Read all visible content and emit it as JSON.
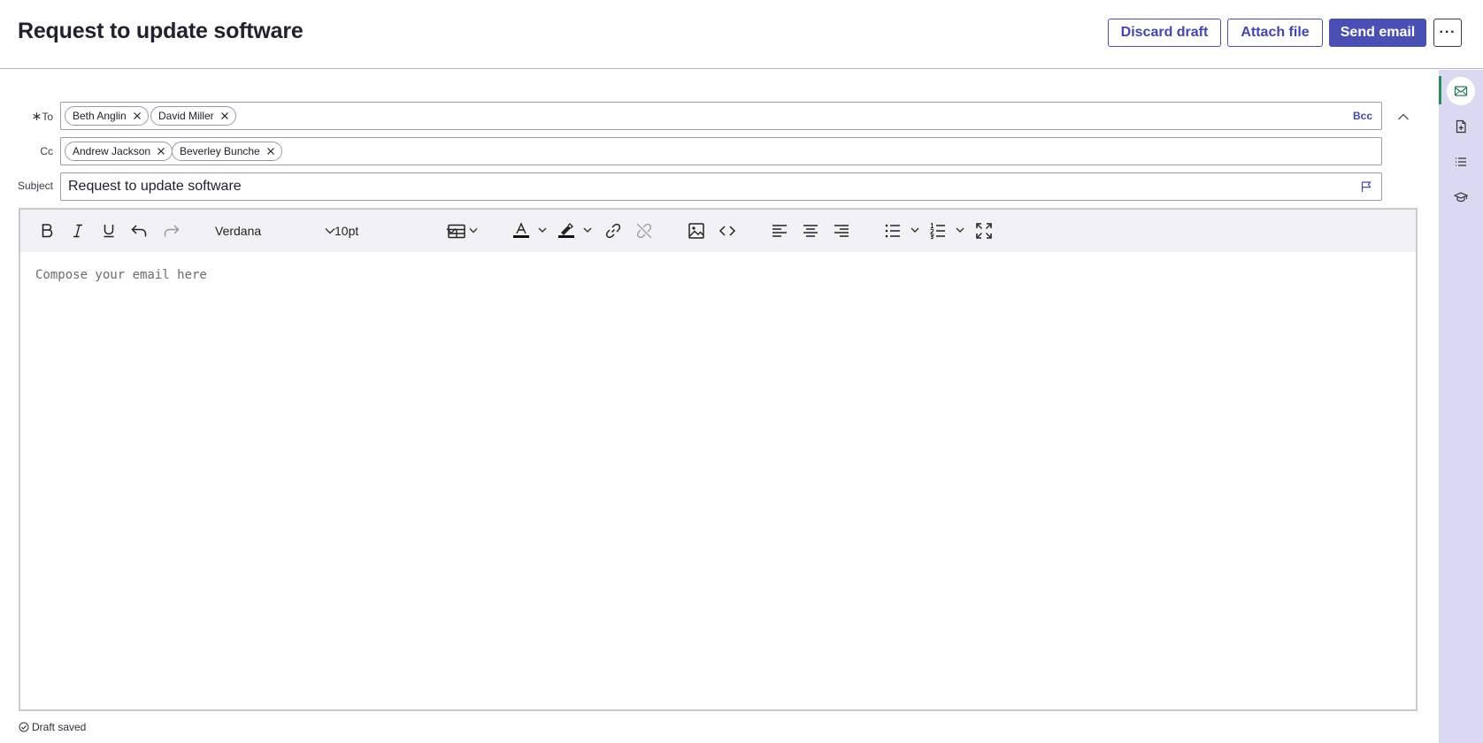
{
  "header": {
    "title": "Request to update software",
    "discard_label": "Discard draft",
    "attach_label": "Attach file",
    "send_label": "Send email",
    "more_label": "···"
  },
  "to": {
    "label": "To",
    "required_marker": "∗",
    "recipients": [
      "Beth Anglin",
      "David Miller"
    ],
    "bcc_label": "Bcc"
  },
  "cc": {
    "label": "Cc",
    "recipients": [
      "Andrew Jackson",
      "Beverley Bunche"
    ]
  },
  "subject": {
    "label": "Subject",
    "value": "Request to update software"
  },
  "toolbar": {
    "font_family": "Verdana",
    "font_size": "10pt",
    "text_color": "#111111",
    "highlight_color": "#111111"
  },
  "editor": {
    "placeholder": "Compose your email here"
  },
  "footer": {
    "status": "Draft saved"
  },
  "colors": {
    "accent": "#4a4fb3",
    "rail": "#d9daf1",
    "rail_selected": "#2e8b57"
  },
  "rail_icons": [
    "email-compose-icon",
    "new-document-icon",
    "list-icon",
    "graduation-cap-icon"
  ]
}
